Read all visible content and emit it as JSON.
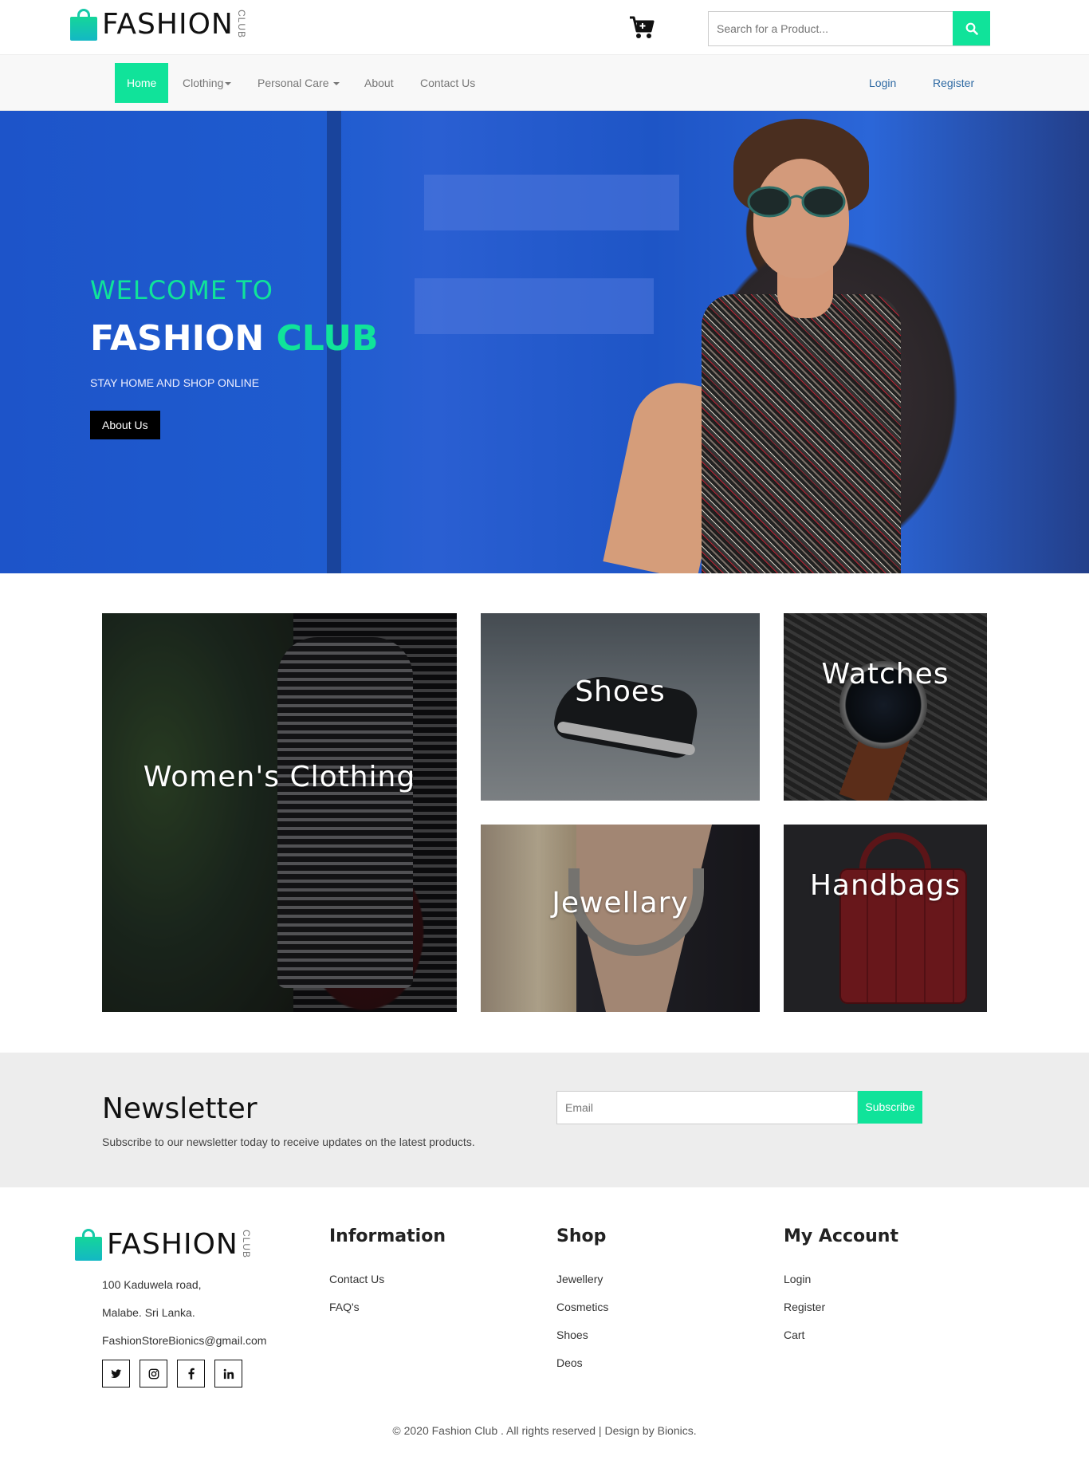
{
  "header": {
    "logo_word": "FASHION",
    "logo_sub": "CLUB",
    "search_placeholder": "Search for a Product...",
    "cart_icon": "cart-icon",
    "search_icon": "search-icon"
  },
  "nav": {
    "items": [
      {
        "label": "Home",
        "active": true
      },
      {
        "label": "Clothing",
        "dropdown": true
      },
      {
        "label": "Personal Care",
        "dropdown": true
      },
      {
        "label": "About"
      },
      {
        "label": "Contact Us"
      }
    ],
    "login": "Login",
    "register": "Register"
  },
  "hero": {
    "welcome": "WELCOME TO",
    "brand_main": "FASHION",
    "brand_accent": "CLUB",
    "tagline": "STAY HOME AND SHOP ONLINE",
    "button": "About Us"
  },
  "categories": [
    {
      "label": "Women's Clothing"
    },
    {
      "label": "Shoes"
    },
    {
      "label": "Watches"
    },
    {
      "label": "Jewellary"
    },
    {
      "label": "Handbags"
    }
  ],
  "newsletter": {
    "title": "Newsletter",
    "text": "Subscribe to our newsletter today to receive updates on the latest products.",
    "email_placeholder": "Email",
    "button": "Subscribe"
  },
  "footer": {
    "address_line1": "100 Kaduwela road,",
    "address_line2": "Malabe. Sri Lanka.",
    "email": "FashionStoreBionics@gmail.com",
    "social": [
      "twitter-icon",
      "instagram-icon",
      "facebook-icon",
      "linkedin-icon"
    ],
    "columns": [
      {
        "title": "Information",
        "links": [
          "Contact Us",
          "FAQ's"
        ]
      },
      {
        "title": "Shop",
        "links": [
          "Jewellery",
          "Cosmetics",
          "Shoes",
          "Deos"
        ]
      },
      {
        "title": "My Account",
        "links": [
          "Login",
          "Register",
          "Cart"
        ]
      }
    ],
    "copyright": "© 2020 Fashion Club . All rights reserved | Design by Bionics."
  },
  "colors": {
    "accent": "#10e39a",
    "hero_blue": "#1f5ccf",
    "link_blue": "#2f6aa3"
  }
}
